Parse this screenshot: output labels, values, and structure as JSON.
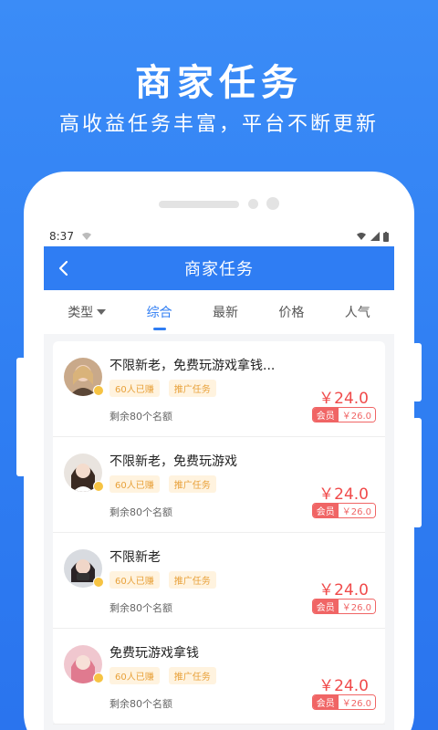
{
  "promo": {
    "title": "商家任务",
    "subtitle": "高收益任务丰富，平台不断更新"
  },
  "status_bar": {
    "time": "8:37"
  },
  "app_bar": {
    "title": "商家任务"
  },
  "tabs": [
    {
      "label": "类型",
      "has_dropdown": true,
      "active": false
    },
    {
      "label": "综合",
      "active": true
    },
    {
      "label": "最新",
      "active": false
    },
    {
      "label": "价格",
      "active": false
    },
    {
      "label": "人气",
      "active": false
    }
  ],
  "tasks": [
    {
      "title": "不限新老，免费玩游戏拿钱...",
      "tags": [
        "60人已赚",
        "推广任务"
      ],
      "remaining": "剩余80个名额",
      "price": "￥24.0",
      "vip_label": "会员",
      "vip_price": "￥26.0"
    },
    {
      "title": "不限新老，免费玩游戏",
      "tags": [
        "60人已赚",
        "推广任务"
      ],
      "remaining": "剩余80个名额",
      "price": "￥24.0",
      "vip_label": "会员",
      "vip_price": "￥26.0"
    },
    {
      "title": "不限新老",
      "tags": [
        "60人已赚",
        "推广任务"
      ],
      "remaining": "剩余80个名额",
      "price": "￥24.0",
      "vip_label": "会员",
      "vip_price": "￥26.0"
    },
    {
      "title": "免费玩游戏拿钱",
      "tags": [
        "60人已赚",
        "推广任务"
      ],
      "remaining": "剩余80个名额",
      "price": "￥24.0",
      "vip_label": "会员",
      "vip_price": "￥26.0"
    }
  ],
  "colors": {
    "brand_blue": "#2f7df3",
    "price_red": "#f04a4a",
    "tag_orange": "#e8a13a"
  }
}
